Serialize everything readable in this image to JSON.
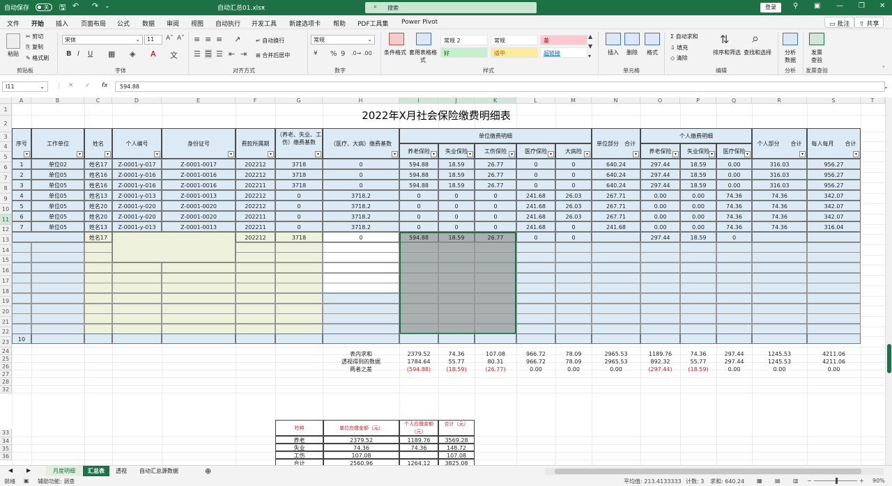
{
  "titlebar": {
    "autosave": "自动保存",
    "autosave_state": "关",
    "filename": "自动汇总01.xlsx",
    "search_placeholder": "搜索",
    "login": "登录"
  },
  "menu": {
    "items": [
      "文件",
      "开始",
      "插入",
      "页面布局",
      "公式",
      "数据",
      "审阅",
      "视图",
      "自动执行",
      "开发工具",
      "新建选项卡",
      "帮助",
      "PDF工具集",
      "Power Pivot"
    ],
    "comment": "批注",
    "share": "共享"
  },
  "ribbon": {
    "clipboard": {
      "paste": "粘贴",
      "cut": "剪切",
      "copy": "复制",
      "format_painter": "格式刷",
      "label": "剪贴板"
    },
    "font": {
      "name": "宋体",
      "size": "11",
      "label": "字体",
      "bold": "B",
      "italic": "I",
      "underline": "U"
    },
    "align": {
      "wrap": "自动换行",
      "merge": "合并后居中",
      "label": "对齐方式"
    },
    "number": {
      "format": "常规",
      "label": "数字",
      "percent": "%",
      "comma": "9"
    },
    "styles": {
      "cond": "条件格式",
      "table": "套用表格格式",
      "label": "样式",
      "cells": [
        {
          "t": "常规 2",
          "c": "#ffffff",
          "f": "#222222"
        },
        {
          "t": "常规",
          "c": "#ffffff",
          "f": "#222222"
        },
        {
          "t": "差",
          "c": "#ffc7ce",
          "f": "#9c0006"
        },
        {
          "t": "好",
          "c": "#c6efce",
          "f": "#006100"
        },
        {
          "t": "适中",
          "c": "#ffeb9c",
          "f": "#9c5700"
        },
        {
          "t": "超链接",
          "c": "#ffffff",
          "f": "#0563c1"
        }
      ]
    },
    "cells_grp": {
      "insert": "插入",
      "delete": "删除",
      "format": "格式",
      "label": "单元格"
    },
    "edit": {
      "autosum": "自动求和",
      "fill": "填充",
      "clear": "清除",
      "sort": "排序和筛选",
      "find": "查找和选择",
      "label": "编辑"
    },
    "analysis": {
      "btn": "分析数据",
      "label": "分析"
    },
    "invoice": {
      "btn": "发票查验",
      "label": "发票查验"
    }
  },
  "formula": {
    "namebox": "I11",
    "value": "594.88",
    "fx": "fx"
  },
  "columns": [
    "A",
    "B",
    "C",
    "D",
    "E",
    "F",
    "G",
    "H",
    "I",
    "J",
    "K",
    "L",
    "M",
    "N",
    "O",
    "P",
    "Q",
    "R",
    "S",
    "T"
  ],
  "rows": [
    "1",
    "2",
    "3",
    "4",
    "5",
    "6",
    "7",
    "8",
    "9",
    "10",
    "11",
    "12",
    "13",
    "14",
    "15",
    "16",
    "17",
    "18",
    "19",
    "20",
    "21",
    "22",
    "23",
    "24",
    "25",
    "26",
    "27",
    "28",
    "32",
    "33",
    "34",
    "35",
    "36"
  ],
  "sheet": {
    "title": "2022年X月社会保险缴费明细表",
    "h_seq": "序号",
    "h_unit": "工作单位",
    "h_name": "姓名",
    "h_pid": "个人编号",
    "h_idcard": "身份证号",
    "h_period": "费款所属期",
    "h_base1": "（养老、失业、工伤）缴费基数",
    "h_base2": "（医疗、大病）缴费基数",
    "h_unit_detail": "单位缴费明细",
    "h_pension": "养老保险",
    "h_unemp": "失业保险",
    "h_injury": "工伤保险",
    "h_medical": "医疗保险",
    "h_serious": "大病险",
    "h_unit_total": "单位部分　合计",
    "h_personal_detail": "个人缴费明细",
    "h_p_pension": "养老保险",
    "h_p_unemp": "失业保险",
    "h_p_medical": "医疗保险",
    "h_personal_total": "个人部分　　合计",
    "h_monthly": "每人每月　　合计",
    "data": [
      [
        "1",
        "单位02",
        "姓名17",
        "Z-0001-y-017",
        "Z-0001-0017",
        "202212",
        "3718",
        "0",
        "594.88",
        "18.59",
        "26.77",
        "0",
        "0",
        "640.24",
        "297.44",
        "18.59",
        "0.00",
        "316.03",
        "956.27"
      ],
      [
        "2",
        "单位05",
        "姓名16",
        "Z-0001-y-016",
        "Z-0001-0016",
        "202212",
        "3718",
        "0",
        "594.88",
        "18.59",
        "26.77",
        "0",
        "0",
        "640.24",
        "297.44",
        "18.59",
        "0.00",
        "316.03",
        "956.27"
      ],
      [
        "3",
        "单位05",
        "姓名16",
        "Z-0001-y-016",
        "Z-0001-0016",
        "202211",
        "3718",
        "0",
        "594.88",
        "18.59",
        "26.77",
        "0",
        "0",
        "640.24",
        "297.44",
        "18.59",
        "0.00",
        "316.03",
        "956.27"
      ],
      [
        "4",
        "单位05",
        "姓名13",
        "Z-0001-y-013",
        "Z-0001-0013",
        "202212",
        "0",
        "3718.2",
        "0",
        "0",
        "0",
        "241.68",
        "26.03",
        "267.71",
        "0.00",
        "0.00",
        "74.36",
        "74.36",
        "342.07"
      ],
      [
        "5",
        "单位05",
        "姓名20",
        "Z-0001-y-020",
        "Z-0001-0020",
        "202212",
        "0",
        "3718.2",
        "0",
        "0",
        "0",
        "241.68",
        "26.03",
        "267.71",
        "0.00",
        "0.00",
        "74.36",
        "74.36",
        "342.07"
      ],
      [
        "6",
        "单位05",
        "姓名20",
        "Z-0001-y-020",
        "Z-0001-0020",
        "202211",
        "0",
        "3718.2",
        "0",
        "0",
        "0",
        "241.68",
        "26.03",
        "267.71",
        "0.00",
        "0.00",
        "74.36",
        "74.36",
        "342.07"
      ],
      [
        "7",
        "单位05",
        "姓名13",
        "Z-0001-y-013",
        "Z-0001-0013",
        "202211",
        "0",
        "3718.2",
        "0",
        "0",
        "0",
        "241.68",
        "0",
        "241.68",
        "0.00",
        "0.00",
        "74.36",
        "74.36",
        "316.04"
      ]
    ],
    "row11": {
      "name": "姓名17",
      "period": "202212",
      "base1": "3718",
      "base2": "0",
      "i": "594.88",
      "j": "18.59",
      "k": "26.77",
      "l": "0",
      "m": "0",
      "o": "297.44",
      "p": "18.59",
      "q": "0"
    },
    "row21_a": "10",
    "sum_label1": "表内求和",
    "sum_label2": "透视得到的数据",
    "sum_label3": "两者之差",
    "sum1": [
      "2379.52",
      "74.36",
      "107.08",
      "966.72",
      "78.09",
      "2965.53",
      "1189.76",
      "74.36",
      "297.44",
      "1245.53",
      "4211.06"
    ],
    "sum2": [
      "1784.64",
      "55.77",
      "80.31",
      "966.72",
      "78.09",
      "2965.53",
      "892.32",
      "55.77",
      "297.44",
      "1245.53",
      "4211.06"
    ],
    "sum3": [
      "(594.88)",
      "(18.59)",
      "(26.77)",
      "0.00",
      "0.00",
      "0.00",
      "(297.44)",
      "(18.59)",
      "0.00",
      "0.00",
      "0.00"
    ],
    "small": {
      "h1": "险种",
      "h2": "单位应缴金额（元）",
      "h3": "个人应缴金额（元）",
      "h4": "合计（元）",
      "rows": [
        [
          "养老",
          "2379.52",
          "1189.76",
          "3569.28"
        ],
        [
          "失业",
          "74.36",
          "74.36",
          "148.72"
        ],
        [
          "工伤",
          "107.08",
          "",
          "107.08"
        ],
        [
          "合计",
          "2560.96",
          "1264.12",
          "3825.08"
        ]
      ]
    }
  },
  "tabs": [
    "月度明细",
    "汇总表",
    "透视",
    "自动汇总源数据"
  ],
  "active_tab": "汇总表",
  "status": {
    "ready": "就绪",
    "access": "辅助功能: 调查",
    "avg": "平均值: 213.4133333",
    "count": "计数: 3",
    "sum": "求和: 640.24",
    "zoom": "90%"
  }
}
